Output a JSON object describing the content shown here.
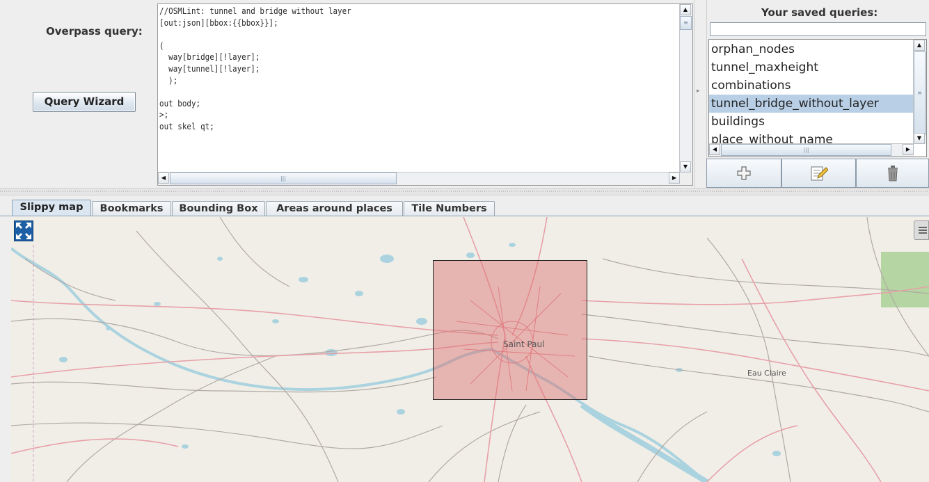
{
  "query_panel": {
    "label": "Overpass query:",
    "wizard_button": "Query Wizard",
    "code": "//OSMLint: tunnel and bridge without layer\n[out:json][bbox:{{bbox}}];\n\n(\n  way[bridge][!layer];\n  way[tunnel][!layer];\n  );\n\nout body;\n>;\nout skel qt;"
  },
  "saved_panel": {
    "title": "Your saved queries:",
    "filter_value": "",
    "items": [
      {
        "label": "orphan_nodes",
        "selected": false
      },
      {
        "label": "tunnel_maxheight",
        "selected": false
      },
      {
        "label": "combinations",
        "selected": false
      },
      {
        "label": "tunnel_bridge_without_layer",
        "selected": true
      },
      {
        "label": "buildings",
        "selected": false
      },
      {
        "label": "place_without_name",
        "selected": false
      }
    ],
    "actions": [
      {
        "name": "add",
        "icon": "plus-icon"
      },
      {
        "name": "edit",
        "icon": "edit-icon"
      },
      {
        "name": "delete",
        "icon": "trash-icon"
      }
    ]
  },
  "tabs": [
    {
      "label": "Slippy map",
      "active": true
    },
    {
      "label": "Bookmarks",
      "active": false
    },
    {
      "label": "Bounding Box",
      "active": false
    },
    {
      "label": "Areas around places",
      "active": false
    },
    {
      "label": "Tile Numbers",
      "active": false
    }
  ],
  "map": {
    "labels": {
      "saint_paul": "Saint Paul",
      "eau_claire": "Eau Claire"
    },
    "selection_color": "#dc6e6e",
    "water_color": "#aad3df",
    "road_color": "#e8a2a8"
  }
}
